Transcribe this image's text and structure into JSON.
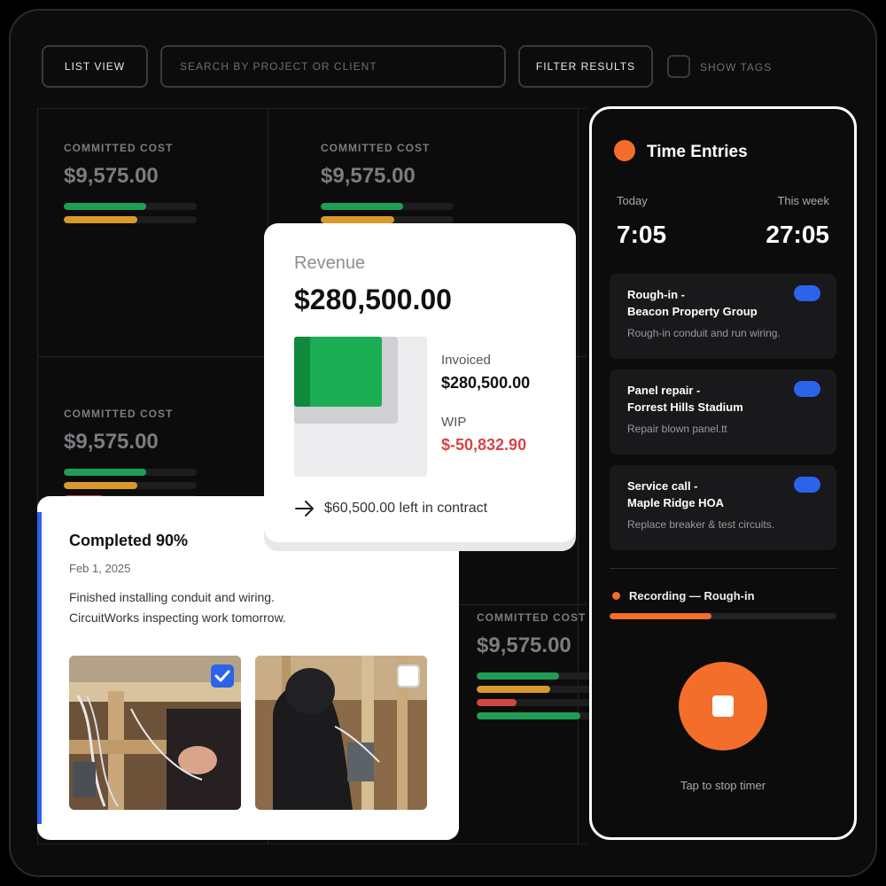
{
  "toolbar": {
    "list_view": "LIST VIEW",
    "search_placeholder": "SEARCH BY PROJECT OR CLIENT",
    "filter": "FILTER RESULTS",
    "show_tags": "SHOW TAGS"
  },
  "cost_cards": [
    {
      "label": "COMMITTED COST",
      "amount": "$9,575.00",
      "bars": [
        {
          "color": "#1f9d55",
          "fraction": 0.62
        },
        {
          "color": "#d99a2b",
          "fraction": 0.55
        }
      ]
    },
    {
      "label": "COMMITTED COST",
      "amount": "$9,575.00",
      "bars": [
        {
          "color": "#1f9d55",
          "fraction": 0.62
        },
        {
          "color": "#d99a2b",
          "fraction": 0.55
        }
      ]
    },
    {
      "label": "COMMITTED COST",
      "amount": "$9,575.00",
      "bars": [
        {
          "color": "#1f9d55",
          "fraction": 0.62
        },
        {
          "color": "#d99a2b",
          "fraction": 0.55
        },
        {
          "color": "#d64545",
          "fraction": 0.3
        }
      ]
    },
    {
      "label": "COMMITTED COST",
      "amount": "$9,575.00",
      "bars": [
        {
          "color": "#1f9d55",
          "fraction": 0.62
        },
        {
          "color": "#d99a2b",
          "fraction": 0.55
        },
        {
          "color": "#d64545",
          "fraction": 0.3
        },
        {
          "color": "#1f9d55",
          "fraction": 0.78
        }
      ]
    }
  ],
  "revenue": {
    "title": "Revenue",
    "amount": "$280,500.00",
    "invoiced_label": "Invoiced",
    "invoiced_value": "$280,500.00",
    "wip_label": "WIP",
    "wip_value": "$-50,832.90",
    "left_in_contract": "$60,500.00 left in contract",
    "colors": {
      "invoiced": "#1aad54",
      "wip": "#d64545"
    }
  },
  "completed": {
    "title": "Completed 90%",
    "date": "Feb 1, 2025",
    "note_line1": "Finished installing conduit and wiring.",
    "note_line2": "CircuitWorks inspecting work tomorrow.",
    "photos": [
      {
        "checked": true
      },
      {
        "checked": false
      }
    ]
  },
  "time_entries": {
    "title": "Time Entries",
    "today_label": "Today",
    "week_label": "This week",
    "today_value": "7:05",
    "week_value": "27:05",
    "entries": [
      {
        "line1": "Rough-in -",
        "line2": "Beacon Property Group",
        "desc": "Rough-in conduit and run wiring."
      },
      {
        "line1": "Panel repair -",
        "line2": "Forrest Hills Stadium",
        "desc": "Repair blown panel.tt"
      },
      {
        "line1": "Service call -",
        "line2": "Maple Ridge HOA",
        "desc": "Replace breaker & test circuits."
      }
    ],
    "recording_label": "Recording — Rough-in",
    "recording_progress": 0.45,
    "stop_hint": "Tap to stop timer",
    "accent": "#f36d2b"
  }
}
